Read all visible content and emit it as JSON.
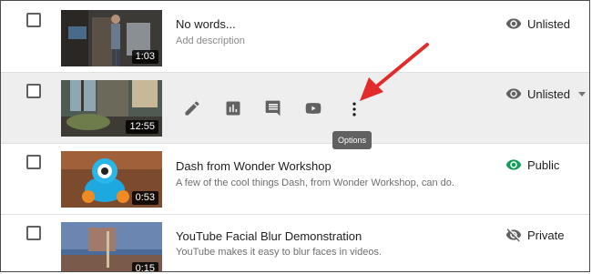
{
  "tooltip": "Options",
  "videos": [
    {
      "title": "No words...",
      "description": "Add description",
      "duration": "1:03",
      "visibility": "Unlisted",
      "visibility_icon": "eye-icon"
    },
    {
      "title": "",
      "description": "",
      "duration": "12:55",
      "visibility": "Unlisted",
      "visibility_icon": "eye-icon",
      "hover_actions": [
        "edit-icon",
        "analytics-icon",
        "comments-icon",
        "play-icon",
        "more-vert-icon"
      ]
    },
    {
      "title": "Dash from Wonder Workshop",
      "description": "A few of the cool things Dash, from Wonder Workshop, can do.",
      "duration": "0:53",
      "visibility": "Public",
      "visibility_icon": "eye-icon",
      "visibility_color": "#0f9d58"
    },
    {
      "title": "YouTube Facial Blur Demonstration",
      "description": "YouTube makes it easy to blur faces in videos.",
      "duration": "0:15",
      "visibility": "Private",
      "visibility_icon": "eye-off-icon"
    }
  ],
  "colors": {
    "accent_arrow": "#e32b2b",
    "public_green": "#0f9d58",
    "hover_row": "#eeeeee"
  }
}
